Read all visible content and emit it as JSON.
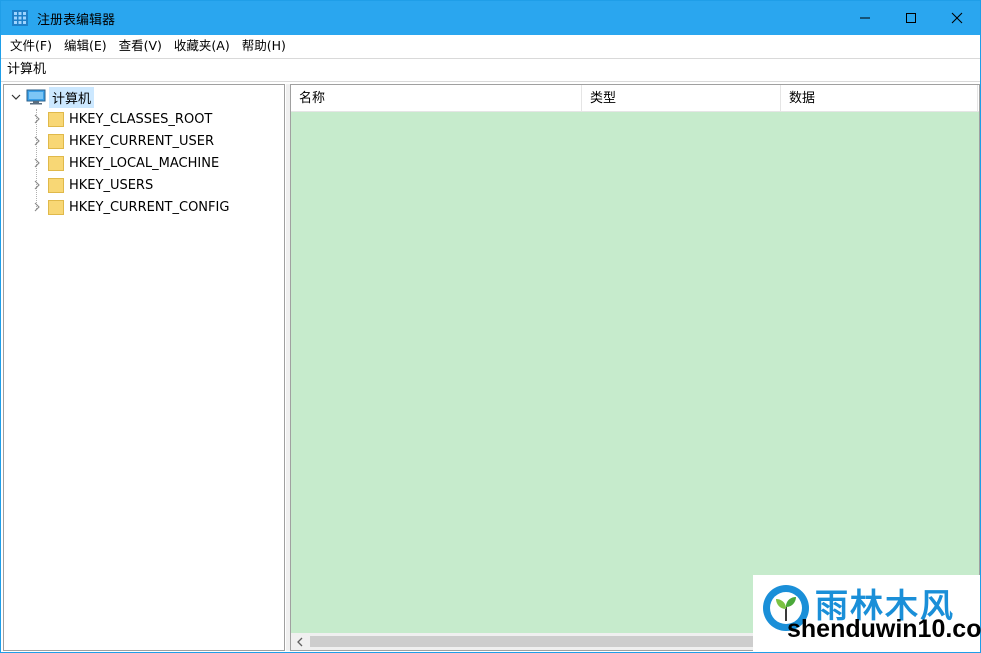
{
  "window": {
    "title": "注册表编辑器",
    "controls": [
      "minimize-icon",
      "maximize-icon",
      "close-icon"
    ]
  },
  "menu": {
    "items": [
      {
        "label": "文件(F)"
      },
      {
        "label": "编辑(E)"
      },
      {
        "label": "查看(V)"
      },
      {
        "label": "收藏夹(A)"
      },
      {
        "label": "帮助(H)"
      }
    ]
  },
  "address": {
    "path": "计算机"
  },
  "tree": {
    "root": {
      "label": "计算机",
      "icon": "computer-icon",
      "expanded": true
    },
    "children": [
      {
        "label": "HKEY_CLASSES_ROOT",
        "icon": "folder-icon"
      },
      {
        "label": "HKEY_CURRENT_USER",
        "icon": "folder-icon"
      },
      {
        "label": "HKEY_LOCAL_MACHINE",
        "icon": "folder-icon"
      },
      {
        "label": "HKEY_USERS",
        "icon": "folder-icon"
      },
      {
        "label": "HKEY_CURRENT_CONFIG",
        "icon": "folder-icon"
      }
    ]
  },
  "list": {
    "columns": [
      {
        "label": "名称"
      },
      {
        "label": "类型"
      },
      {
        "label": "数据"
      }
    ],
    "background": "#c6ebcc"
  },
  "watermark": {
    "title": "雨林木风",
    "url": "shenduwin10.com"
  },
  "colors": {
    "titlebar": "#2aa6ef",
    "selection": "#cce8ff",
    "folder": "#f8d775"
  }
}
